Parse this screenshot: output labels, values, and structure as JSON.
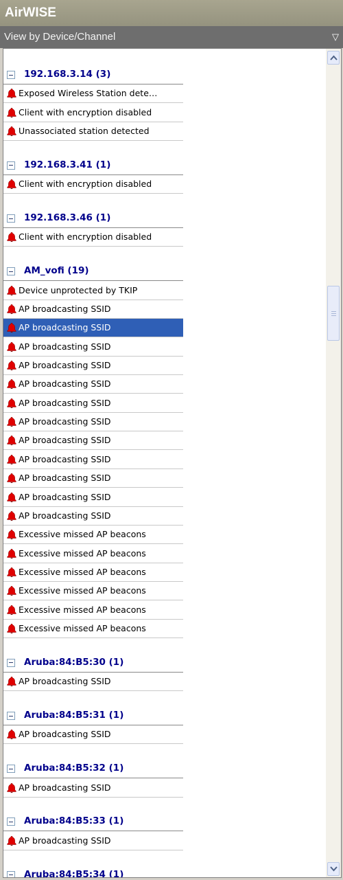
{
  "app": {
    "title": "AirWISE"
  },
  "view_selector": {
    "label": "View by Device/Channel",
    "dropdown_icon": "triangle-down-icon"
  },
  "alerts_tree": {
    "groups": [
      {
        "label": "192.168.3.14 (3)",
        "items": [
          "Exposed Wireless Station dete…",
          "Client with encryption disabled",
          "Unassociated station detected"
        ]
      },
      {
        "label": "192.168.3.41 (1)",
        "items": [
          "Client with encryption disabled"
        ]
      },
      {
        "label": "192.168.3.46 (1)",
        "items": [
          "Client with encryption disabled"
        ]
      },
      {
        "label": "AM_vofi (19)",
        "items": [
          "Device unprotected by TKIP",
          "AP broadcasting SSID",
          "AP broadcasting SSID",
          "AP broadcasting SSID",
          "AP broadcasting SSID",
          "AP broadcasting SSID",
          "AP broadcasting SSID",
          "AP broadcasting SSID",
          "AP broadcasting SSID",
          "AP broadcasting SSID",
          "AP broadcasting SSID",
          "AP broadcasting SSID",
          "AP broadcasting SSID",
          "Excessive missed AP beacons",
          "Excessive missed AP beacons",
          "Excessive missed AP beacons",
          "Excessive missed AP beacons",
          "Excessive missed AP beacons",
          "Excessive missed AP beacons"
        ]
      },
      {
        "label": "Aruba:84:B5:30 (1)",
        "items": [
          "AP broadcasting SSID"
        ]
      },
      {
        "label": "Aruba:84:B5:31 (1)",
        "items": [
          "AP broadcasting SSID"
        ]
      },
      {
        "label": "Aruba:84:B5:32 (1)",
        "items": [
          "AP broadcasting SSID"
        ]
      },
      {
        "label": "Aruba:84:B5:33 (1)",
        "items": [
          "AP broadcasting SSID"
        ]
      },
      {
        "label": "Aruba:84:B5:34 (1)",
        "items": []
      }
    ],
    "selected": {
      "group": 3,
      "item": 2
    },
    "icons": {
      "alert": "alarm-bell-icon",
      "collapse": "collapse-minus-icon"
    }
  },
  "colors": {
    "header_text": "#00008b",
    "selection": "#2f5fb6",
    "alert_bell": "#e00000"
  }
}
